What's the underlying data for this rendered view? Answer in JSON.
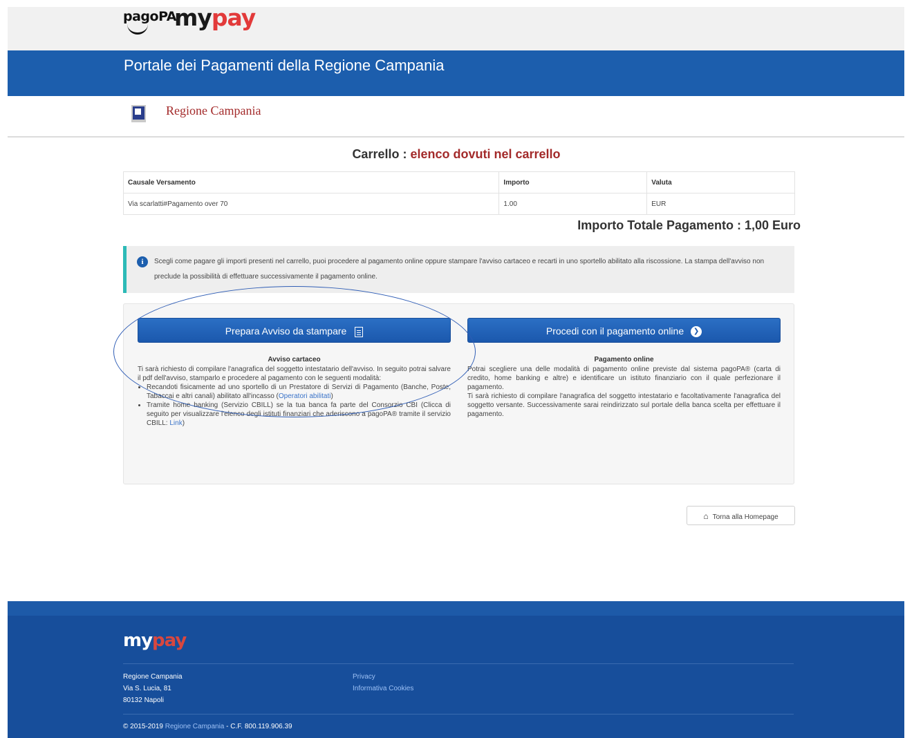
{
  "header": {
    "logo_pagopa": "pagoPA",
    "logo_my": "my",
    "logo_pay": "pay",
    "portal_title": "Portale dei Pagamenti della Regione Campania",
    "regione_name": "Regione Campania"
  },
  "cart": {
    "title_prefix": "Carrello : ",
    "title_suffix": "elenco dovuti nel carrello",
    "columns": [
      "Causale Versamento",
      "Importo",
      "Valuta"
    ],
    "rows": [
      [
        "Via scarlatti#Pagamento over 70",
        "1.00",
        "EUR"
      ]
    ],
    "total_label": "Importo Totale Pagamento : 1,00 Euro"
  },
  "info": {
    "text": "Scegli come pagare gli importi presenti nel carrello, puoi procedere al pagamento online oppure stampare l'avviso cartaceo e recarti in uno sportello abilitato alla riscossione. La stampa dell'avviso non preclude la possibilità di effettuare successivamente il pagamento online."
  },
  "options": {
    "stampa_button": "Prepara Avviso da stampare",
    "online_button": "Procedi con il pagamento online",
    "cartaceo_title": "Avviso cartaceo",
    "cartaceo_intro": "Ti sarà richiesto di compilare l'anagrafica del soggetto intestatario dell'avviso. In seguito potrai salvare il pdf dell'avviso, stamparlo e procedere al pagamento con le seguenti modalità:",
    "cartaceo_bullet1_text": "Recandoti fisicamente ad uno sportello di un Prestatore di Servizi di Pagamento (Banche, Poste, Tabaccai e altri canali) abilitato all'incasso (",
    "cartaceo_bullet1_link": "Operatori abilitati",
    "cartaceo_bullet1_end": ")",
    "cartaceo_bullet2_text": "Tramite home banking (Servizio CBILL) se la tua banca fa parte del Consorzio CBI (Clicca di seguito per visualizzare l'elenco degli istituti finanziari che aderiscono a pagoPA® tramite il servizio CBILL: ",
    "cartaceo_bullet2_link": "Link",
    "cartaceo_bullet2_end": ")",
    "online_title": "Pagamento online",
    "online_text1": "Potrai scegliere una delle modalità di pagamento online previste dal sistema pagoPA® (carta di credito, home banking e altre) e identificare un istituto finanziario con il quale perfezionare il pagamento.",
    "online_text2": "Ti sarà richiesto di compilare l'anagrafica del soggetto intestatario e facoltativamente l'anagrafica del soggetto versante. Successivamente sarai reindirizzato sul portale della banca scelta per effettuare il pagamento."
  },
  "home_button": "Torna alla Homepage",
  "footer": {
    "logo_my": "my",
    "logo_pay": "pay",
    "address": [
      "Regione Campania",
      "Via S. Lucia, 81",
      "80132 Napoli"
    ],
    "links": [
      "Privacy",
      "Informativa Cookies"
    ],
    "copyright_prefix": "© 2015-2019 ",
    "copyright_link": "Regione Campania",
    "copyright_suffix": " - C.F. 800.119.906.39"
  },
  "colors": {
    "primary_blue": "#1c5ead",
    "accent_red": "#a32a2a",
    "info_border": "#2dbab7"
  }
}
